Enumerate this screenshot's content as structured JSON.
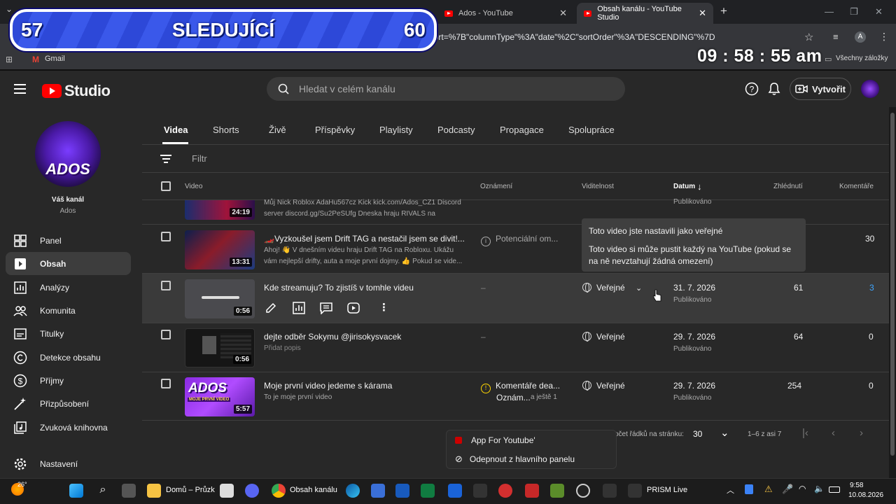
{
  "browser": {
    "tabs": [
      {
        "title": "Ados - YouTube",
        "close": "✕"
      },
      {
        "title": "Obsah kanálu - YouTube Studio",
        "close": "✕"
      }
    ],
    "new_tab": "+",
    "url": "q=&sort=%7B\"columnType\"%3A\"date\"%2C\"sortOrder\"%3A\"DESCENDING\"%7D",
    "bookmark_gmail": "Gmail",
    "bookmarks_all": "Všechny záložky",
    "profile": "A"
  },
  "overlay": {
    "current": "57",
    "label": "SLEDUJÍCÍ",
    "goal": "60",
    "clock": "09 : 58 : 55 am"
  },
  "studio": {
    "logo": "Studio",
    "search_placeholder": "Hledat v celém kanálu",
    "create_label": "Vytvořit"
  },
  "channel": {
    "avatar_text": "ADOS",
    "title": "Váš kanál",
    "name": "Ados"
  },
  "nav": {
    "panel": "Panel",
    "content": "Obsah",
    "analytics": "Analýzy",
    "community": "Komunita",
    "subtitles": "Titulky",
    "copyright": "Detekce obsahu",
    "earn": "Příjmy",
    "customization": "Přizpůsobení",
    "audio": "Zvuková knihovna",
    "settings": "Nastavení"
  },
  "content_tabs": [
    "Videa",
    "Shorts",
    "Živě",
    "Příspěvky",
    "Playlisty",
    "Podcasty",
    "Propagace",
    "Spolupráce"
  ],
  "filter_placeholder": "Filtr",
  "columns": {
    "video": "Video",
    "notice": "Oznámení",
    "visibility": "Viditelnost",
    "date": "Datum",
    "views": "Zhlédnutí",
    "comments": "Komentáře"
  },
  "rows": [
    {
      "duration": "24:19",
      "description": "Můj Nick Roblox AdaHu567cz Kick kick.com/Ados_CZ1 Discord server discord.gg/Su2PeSUfg Dneska hraju RIVALS na Robloxu...",
      "date_status": "Publikováno"
    },
    {
      "title": "🏎️Vyzkoušel jsem Drift TAG a nestačil jsem se divit!...",
      "description": "Ahoj! 👋 V dnešním videu hraju Drift TAG na Robloxu. Ukážu vám nejlepší drifty, auta a moje první dojmy. 👍 Pokud se vide...",
      "duration": "13:31",
      "notice": "Potenciální om...",
      "comments": "30"
    },
    {
      "title": "Kde streamuju? To zjistíš v tomhle videu",
      "duration": "0:56",
      "notice": "–",
      "visibility": "Veřejné",
      "date": "31. 7. 2026",
      "date_status": "Publikováno",
      "views": "61",
      "comments": "3"
    },
    {
      "title": "dejte odběr Sokymu @jirisokysvacek",
      "description": "Přidat popis",
      "duration": "0:56",
      "notice": "–",
      "visibility": "Veřejné",
      "date": "29. 7. 2026",
      "date_status": "Publikováno",
      "views": "64",
      "comments": "0"
    },
    {
      "title": "Moje první video jedeme s kárama",
      "description": "To je moje první video",
      "duration": "5:57",
      "notice": "Komentáře dea...",
      "notice2": "Oznám...",
      "notice2_more": "a ještě 1",
      "visibility": "Veřejné",
      "date": "29. 7. 2026",
      "date_status": "Publikováno",
      "views": "254",
      "comments": "0",
      "thumb_text": "ADOS",
      "thumb_sub": "MOJE PRVNÍ VIDEO"
    }
  ],
  "tooltip": {
    "line1": "Toto video jste nastavili jako veřejné",
    "line2": "Toto video si může pustit každý na YouTube (pokud se na ně nevztahují žádná omezení)"
  },
  "context_menu": {
    "app": "App For Youtube'",
    "unpin": "Odepnout z hlavního panelu"
  },
  "pagination": {
    "rows_label": "očet řádků na stránku:",
    "rows_value": "30",
    "range": "1–6 z asi 7"
  },
  "taskbar": {
    "weather": "26°",
    "explorer": "Domů – Průzk",
    "chrome": "Obsah kanálu",
    "prism": "PRISM Live",
    "time": "9:58",
    "date": "10.08.2026"
  },
  "colors": {
    "accent_red": "#ff0000",
    "link_blue": "#3ea6ff",
    "warning_yellow": "#ffd600",
    "overlay_blue": "#3a58ea"
  }
}
